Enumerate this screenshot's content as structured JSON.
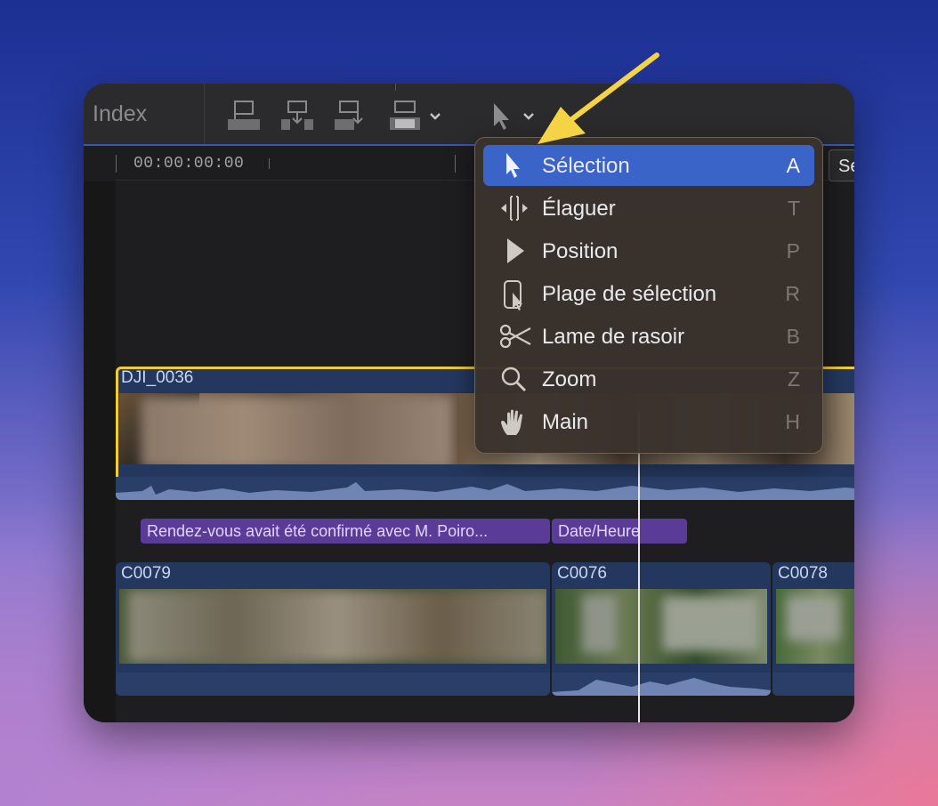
{
  "toolbar": {
    "index_label": "Index",
    "buttons": [
      "connect-clip-icon",
      "insert-clip-icon",
      "append-clip-icon",
      "overwrite-clip-icon",
      "select-tool-icon"
    ]
  },
  "ruler": {
    "timecode": "00:00:00:00"
  },
  "clips": {
    "primary": {
      "name": "DJI_0036"
    },
    "storyline": [
      {
        "name": "C0079"
      },
      {
        "name": "C0076"
      },
      {
        "name": "C0078"
      }
    ]
  },
  "titles": [
    {
      "text": "Rendez-vous avait été confirmé avec M. Poiro..."
    },
    {
      "text": "Date/Heure"
    }
  ],
  "tool_menu": {
    "items": [
      {
        "label": "Sélection",
        "key": "A",
        "icon": "pointer-arrow-icon",
        "active": true
      },
      {
        "label": "Élaguer",
        "key": "T",
        "icon": "trim-icon",
        "active": false
      },
      {
        "label": "Position",
        "key": "P",
        "icon": "position-arrow-icon",
        "active": false
      },
      {
        "label": "Plage de sélection",
        "key": "R",
        "icon": "range-selection-icon",
        "active": false
      },
      {
        "label": "Lame de rasoir",
        "key": "B",
        "icon": "scissors-icon",
        "active": false
      },
      {
        "label": "Zoom",
        "key": "Z",
        "icon": "magnifier-icon",
        "active": false
      },
      {
        "label": "Main",
        "key": "H",
        "icon": "hand-icon",
        "active": false
      }
    ]
  },
  "tooltip": {
    "text": "Se"
  },
  "colors": {
    "selection_highlight": "#3a64c7",
    "selected_clip_outline": "#f1cc34",
    "title_clip": "#5a3c98",
    "annotation_arrow": "#f4d444"
  }
}
